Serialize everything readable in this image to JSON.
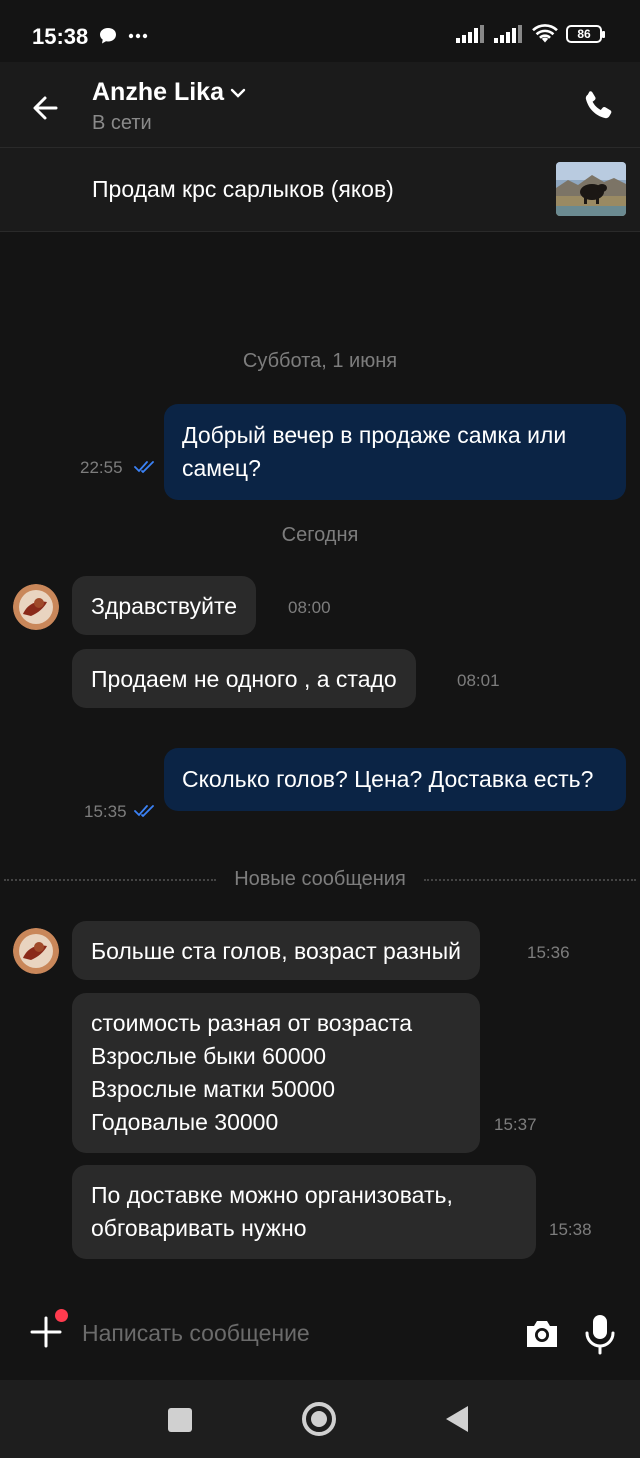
{
  "status_bar": {
    "time": "15:38",
    "battery": "86",
    "icons": [
      "message-icon",
      "more-dots-icon",
      "signal-icon",
      "signal-icon",
      "wifi-icon",
      "battery-icon"
    ]
  },
  "header": {
    "contact_name": "Anzhe Lika",
    "status": "В сети",
    "icons": [
      "back-arrow-icon",
      "chevron-down-icon",
      "phone-icon"
    ]
  },
  "listing": {
    "title": "Продам крс сарлыков (яков)"
  },
  "chat": {
    "date_saturday": "Суббота, 1 июня",
    "date_today": "Сегодня",
    "new_messages": "Новые сообщения",
    "msg1": {
      "text": "Добрый вечер в продаже самка или самец?",
      "time": "22:55",
      "read": true
    },
    "msg2": {
      "text": "Здравствуйте",
      "time": "08:00"
    },
    "msg3": {
      "text": "Продаем не одного , а стадо",
      "time": "08:01"
    },
    "msg4": {
      "text": "Сколько голов? Цена? Доставка есть?",
      "time": "15:35",
      "read": true
    },
    "msg5": {
      "text": "Больше ста голов, возраст разный",
      "time": "15:36"
    },
    "msg6": {
      "lines": [
        "стоимость разная от возраста",
        "Взрослые быки 60000",
        "Взрослые матки 50000",
        "Годовалые 30000"
      ],
      "time": "15:37"
    },
    "msg7": {
      "lines": [
        "По доставке можно организовать,",
        "обговаривать нужно"
      ],
      "time": "15:38"
    }
  },
  "composer": {
    "placeholder": "Написать сообщение",
    "icons": [
      "plus-icon",
      "camera-icon",
      "microphone-icon"
    ]
  },
  "colors": {
    "background": "#141414",
    "outgoing_bubble": "#0b2445",
    "incoming_bubble": "#2a2a2a",
    "read_check": "#3b82f6",
    "notification_dot": "#ff3b4e"
  }
}
